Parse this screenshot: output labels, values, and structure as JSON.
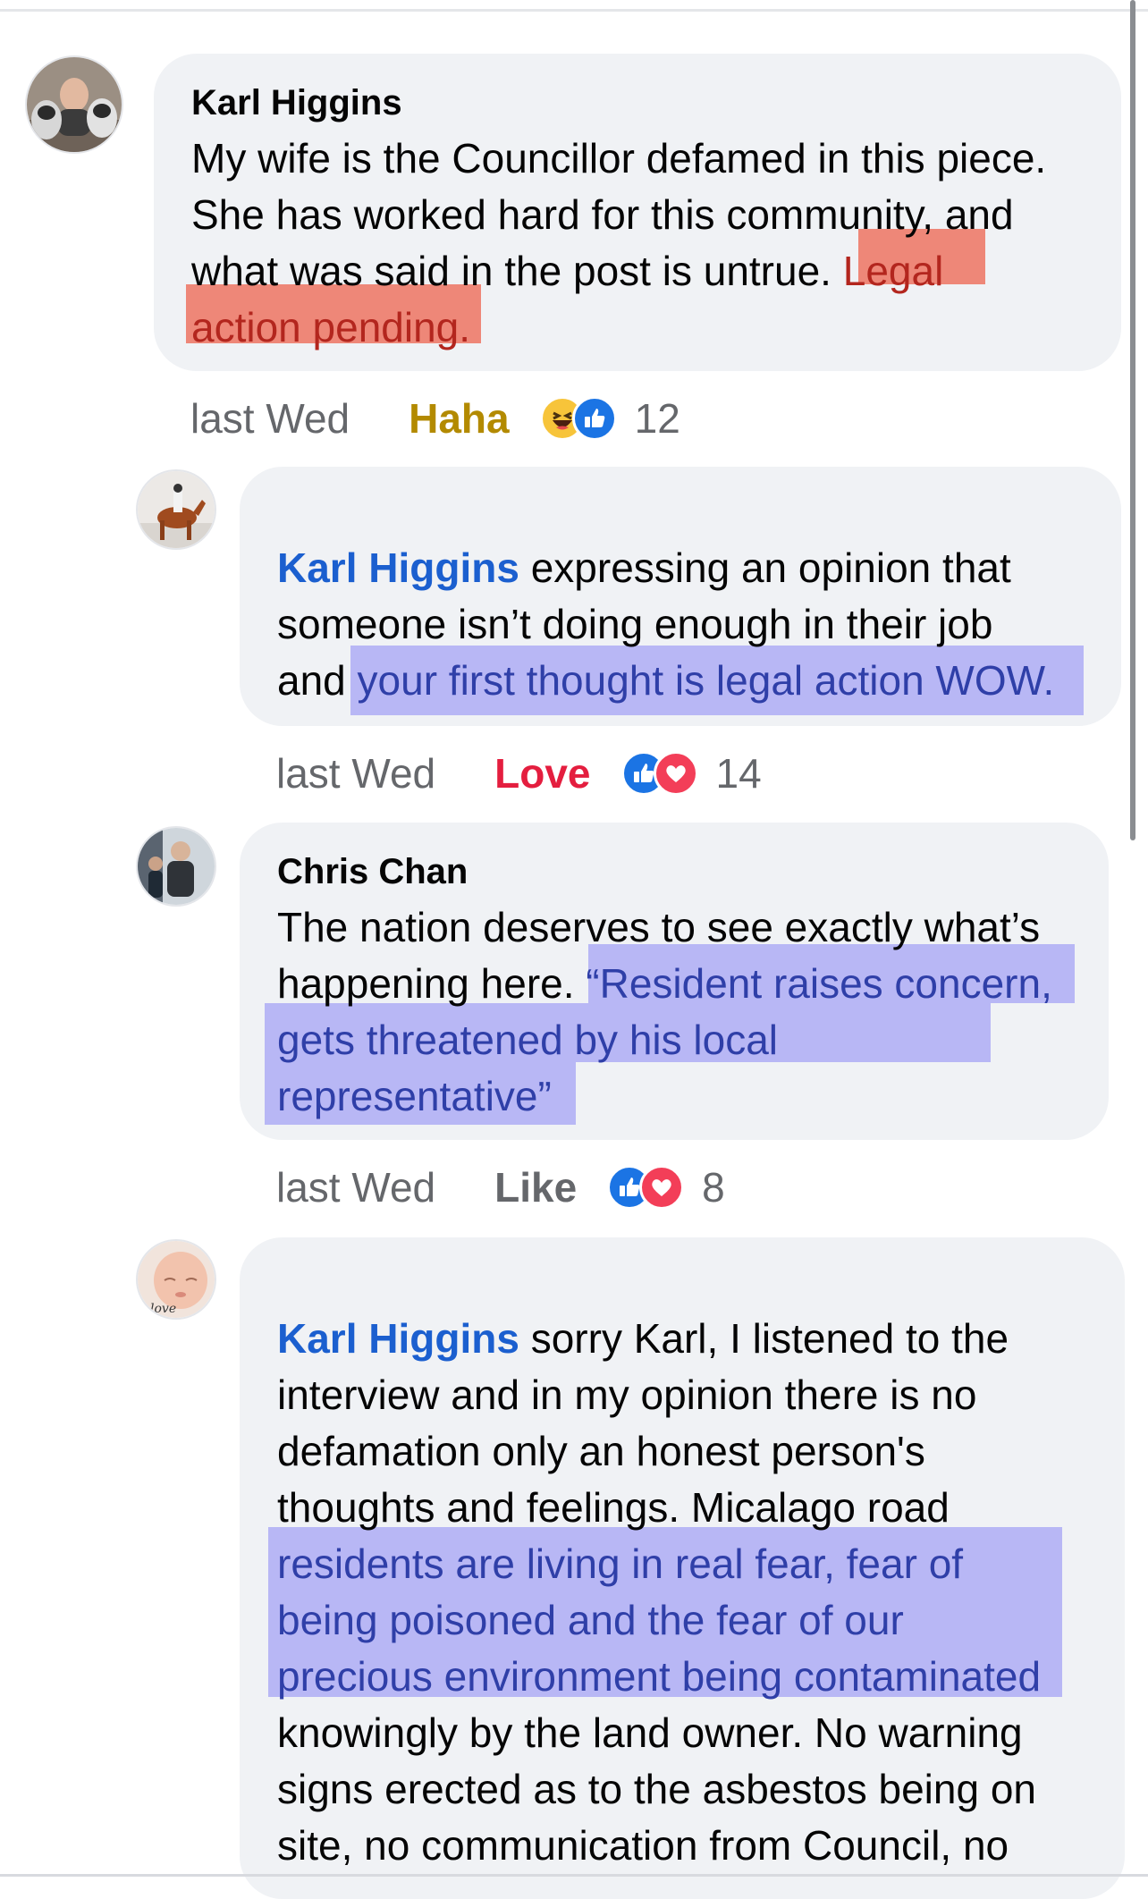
{
  "comments": [
    {
      "author": "Karl Higgins",
      "text_plain": "My wife is the Councillor defamed in this piece.\nShe has worked hard for this community, and\nwhat was said in the post is untrue. ",
      "text_highlight_1": "Legal",
      "text_highlight_2": "action pending.",
      "time": "last Wed",
      "reaction_label": "Haha",
      "reaction_icons": [
        "haha-icon",
        "like-icon"
      ],
      "reaction_count": "12"
    },
    {
      "mention": "Karl Higgins",
      "text_plain": " expressing an opinion that\nsomeone isn’t doing enough in their job\nand ",
      "text_highlight": "your first thought is legal action WOW.",
      "time": "last Wed",
      "reaction_label": "Love",
      "reaction_icons": [
        "like-icon",
        "love-icon"
      ],
      "reaction_count": "14"
    },
    {
      "author": "Chris Chan",
      "text_plain": "The nation deserves to see exactly what’s\nhappening here. ",
      "text_highlight": "“Resident raises concern,\ngets threatened by his local\nrepresentative”",
      "time": "last Wed",
      "reaction_label": "Like",
      "reaction_icons": [
        "like-icon",
        "love-icon"
      ],
      "reaction_count": "8"
    },
    {
      "mention": "Karl Higgins",
      "text_plain_1": " sorry Karl, I listened to the\ninterview and in my opinion there is no\ndefamation only an honest person's\nthoughts and feelings. Micalago road\n",
      "text_highlight": "residents are living in real fear, fear of\nbeing poisoned and the fear of our\nprecious environment being contaminated",
      "text_plain_2": "\nknowingly by the land owner. No warning\nsigns erected as to the asbestos being on\nsite, no communication from Council, no",
      "avatar_caption": "love"
    }
  ],
  "colors": {
    "highlight_red": "#ee8778",
    "highlight_blue": "#b8b7f5",
    "mention": "#1b5fcf",
    "haha": "#b38a00",
    "love": "#e41e3f",
    "like_label": "#65676b"
  }
}
